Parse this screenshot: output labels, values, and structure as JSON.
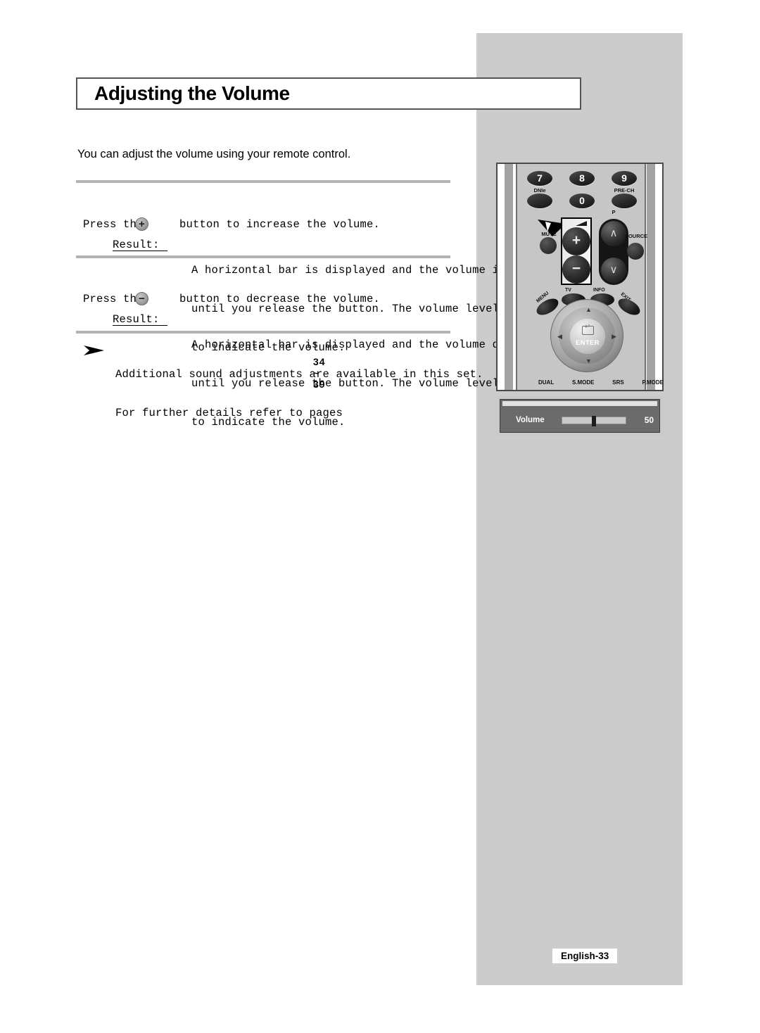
{
  "document": {
    "title": "Adjusting the Volume",
    "intro": "You can adjust the volume using your remote control.",
    "footer": "English-33"
  },
  "steps": [
    {
      "lead": "Press the",
      "button_glyph": "+",
      "button_name": "volume-up",
      "tail": "button to increase the volume.",
      "result_label": "Result:",
      "result_lines": [
        "A horizontal bar is displayed and the volume increases",
        "until you release the button. The volume level is displayed",
        "to indicate the volume."
      ]
    },
    {
      "lead": "Press the",
      "button_glyph": "−",
      "button_name": "volume-down",
      "tail": "button to decrease the volume.",
      "result_label": "Result:",
      "result_lines": [
        "A horizontal bar is displayed and the volume decreases",
        "until you release the button. The volume level is displayed",
        "to indicate the volume."
      ]
    }
  ],
  "note": {
    "lines": [
      "Additional sound adjustments are available in this set.",
      "For further details refer to pages"
    ],
    "page_reference": "34 ~ 39"
  },
  "remote": {
    "number_keys": [
      "7",
      "8",
      "9",
      "0"
    ],
    "labels": {
      "dnie": "DNIe",
      "pre_ch": "PRE-CH",
      "mute": "MUTE",
      "p": "P",
      "source": "SOURCE",
      "tv": "TV",
      "info": "INFO",
      "menu": "MENU",
      "exit": "EXIT",
      "enter": "ENTER"
    },
    "volume_up_glyph": "+",
    "volume_down_glyph": "−",
    "ch_up_glyph": "∧",
    "ch_down_glyph": "∨",
    "nav_up": "▲",
    "nav_down": "▼",
    "nav_left": "◀",
    "nav_right": "▶",
    "bottom_labels": [
      "DUAL",
      "S.MODE",
      "SRS",
      "P.MODE"
    ]
  },
  "osd": {
    "label": "Volume",
    "value": "50",
    "slider_percent": 50
  },
  "colors": {
    "gray_column": "#cccccc",
    "rule": "#b3b3b3",
    "osd_background": "#6b6b6b",
    "remote_body": "#c6c6c6"
  }
}
